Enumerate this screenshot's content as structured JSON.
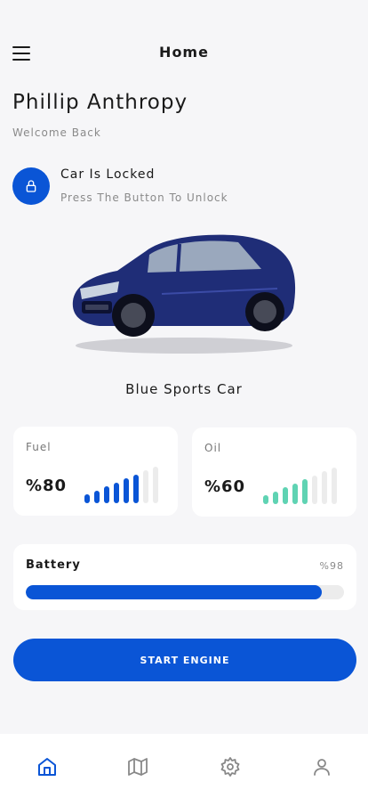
{
  "header": {
    "title": "Home"
  },
  "user": {
    "name": "Phillip Anthropy",
    "greeting": "Welcome Back"
  },
  "lock": {
    "title": "Car Is Locked",
    "subtitle": "Press The Button To Unlock"
  },
  "car": {
    "name": "Blue Sports Car"
  },
  "fuel": {
    "label": "Fuel",
    "value": "%80",
    "level": 0.8,
    "color": "#0a55d6"
  },
  "oil": {
    "label": "Oil",
    "value": "%60",
    "level": 0.6,
    "color": "#5fd3b3"
  },
  "battery": {
    "label": "Battery",
    "value": "%98",
    "level": 0.93,
    "color": "#0a55d6"
  },
  "actions": {
    "start_label": "START ENGINE"
  },
  "tabs": [
    {
      "name": "home",
      "icon": "home-icon",
      "active": true
    },
    {
      "name": "map",
      "icon": "map-icon",
      "active": false
    },
    {
      "name": "settings",
      "icon": "gear-icon",
      "active": false
    },
    {
      "name": "profile",
      "icon": "user-icon",
      "active": false
    }
  ],
  "colors": {
    "accent": "#0a55d6",
    "inactive": "#888888",
    "background": "#f6f6f8"
  }
}
